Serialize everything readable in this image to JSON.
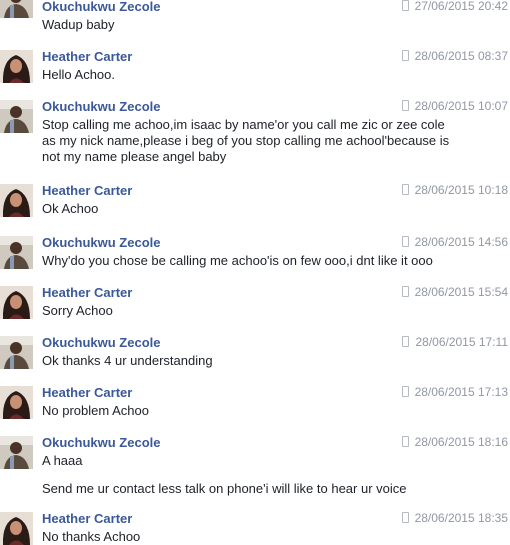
{
  "messages": [
    {
      "sender": "Okuchukwu Zecole",
      "time": "27/06/2015 20:42",
      "avatar": "man-avatar",
      "lines": [
        "Wadup baby"
      ]
    },
    {
      "sender": "Heather Carter",
      "time": "28/06/2015 08:37",
      "avatar": "woman-avatar",
      "lines": [
        "Hello Achoo."
      ]
    },
    {
      "sender": "Okuchukwu Zecole",
      "time": "28/06/2015 10:07",
      "avatar": "man-avatar",
      "lines": [
        "Stop calling me achoo,im isaac by name'or you call me zic or zee cole",
        "as my nick name,please i beg of you stop calling me achool'because is",
        "not my name please angel baby"
      ]
    },
    {
      "sender": "Heather Carter",
      "time": "28/06/2015 10:18",
      "avatar": "woman-avatar",
      "lines": [
        "Ok Achoo"
      ]
    },
    {
      "sender": "Okuchukwu Zecole",
      "time": "28/06/2015 14:56",
      "avatar": "man-avatar",
      "lines": [
        "Why'do you chose be calling me achoo'is on few ooo,i dnt like it ooo"
      ]
    },
    {
      "sender": "Heather Carter",
      "time": "28/06/2015 15:54",
      "avatar": "woman-avatar",
      "lines": [
        "Sorry Achoo"
      ]
    },
    {
      "sender": "Okuchukwu Zecole",
      "time": "28/06/2015 17:11",
      "avatar": "man-avatar",
      "lines": [
        "Ok thanks 4 ur understanding"
      ]
    },
    {
      "sender": "Heather Carter",
      "time": "28/06/2015 17:13",
      "avatar": "woman-avatar",
      "lines": [
        "No problem Achoo"
      ]
    },
    {
      "sender": "Okuchukwu Zecole",
      "time": "28/06/2015 18:16",
      "avatar": "man-avatar",
      "lines": [
        "A haaa"
      ],
      "extra": "Send me ur contact less talk on phone'i will like to hear ur voice"
    },
    {
      "sender": "Heather Carter",
      "time": "28/06/2015 18:35",
      "avatar": "woman-avatar",
      "lines": [
        "No thanks Achoo"
      ]
    }
  ]
}
